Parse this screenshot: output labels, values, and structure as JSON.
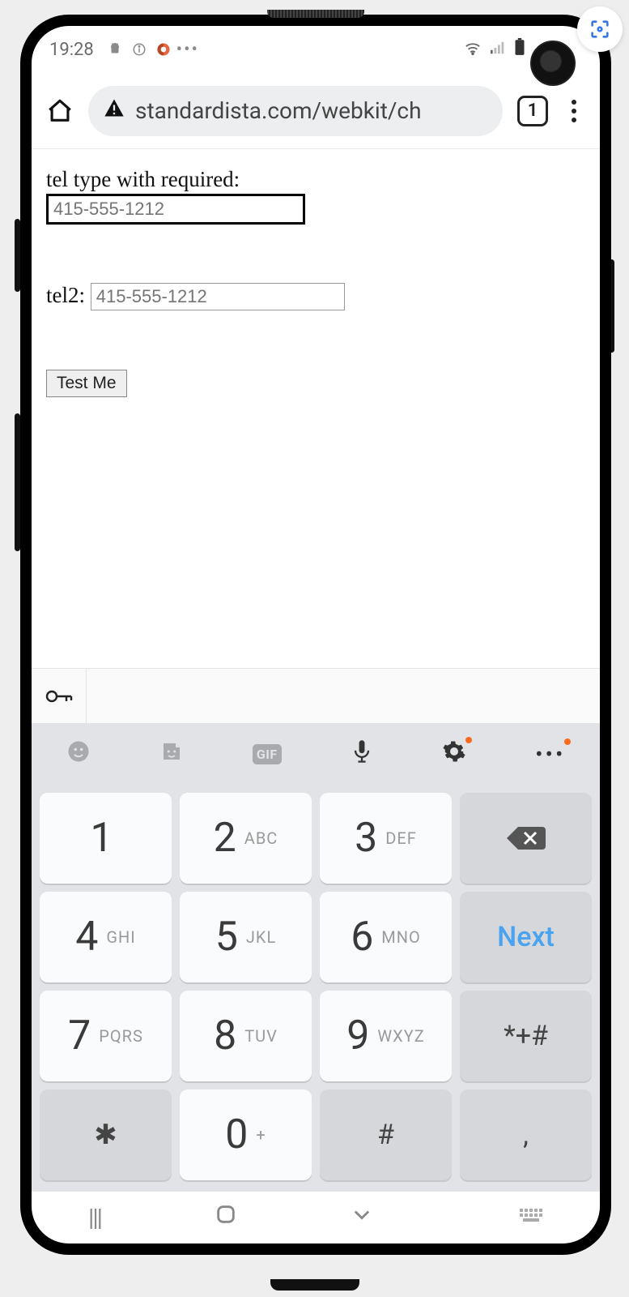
{
  "statusbar": {
    "time": "19:28",
    "left_icons": [
      "android-icon",
      "info-icon",
      "swirl-icon",
      "more-icon"
    ],
    "right_icons": [
      "wifi-icon",
      "signal-icon",
      "battery-icon"
    ]
  },
  "browser": {
    "security_icon": "warning-icon",
    "url": "standardista.com/webkit/ch",
    "tab_count": "1"
  },
  "page": {
    "tel1_label": "tel type with required:",
    "tel1_placeholder": "415-555-1212",
    "tel2_label": "tel2:",
    "tel2_placeholder": "415-555-1212",
    "button_label": "Test Me"
  },
  "keyboard_toolbar": {
    "items": [
      "emoji-icon",
      "sticker-icon",
      "GIF",
      "mic-icon",
      "settings-icon",
      "more-icon"
    ]
  },
  "keys": {
    "r1": [
      {
        "digit": "1",
        "letters": ""
      },
      {
        "digit": "2",
        "letters": "ABC"
      },
      {
        "digit": "3",
        "letters": "DEF"
      },
      {
        "action": "backspace"
      }
    ],
    "r2": [
      {
        "digit": "4",
        "letters": "GHI"
      },
      {
        "digit": "5",
        "letters": "JKL"
      },
      {
        "digit": "6",
        "letters": "MNO"
      },
      {
        "action": "Next"
      }
    ],
    "r3": [
      {
        "digit": "7",
        "letters": "PQRS"
      },
      {
        "digit": "8",
        "letters": "TUV"
      },
      {
        "digit": "9",
        "letters": "WXYZ"
      },
      {
        "sym": "*+#"
      }
    ],
    "r4": [
      {
        "sym": "✱"
      },
      {
        "digit": "0",
        "letters": "+"
      },
      {
        "sym": "#"
      },
      {
        "sym": ","
      }
    ]
  },
  "navbar": [
    "recents-icon",
    "home-icon",
    "back-icon",
    "keyboard-toggle-icon"
  ]
}
